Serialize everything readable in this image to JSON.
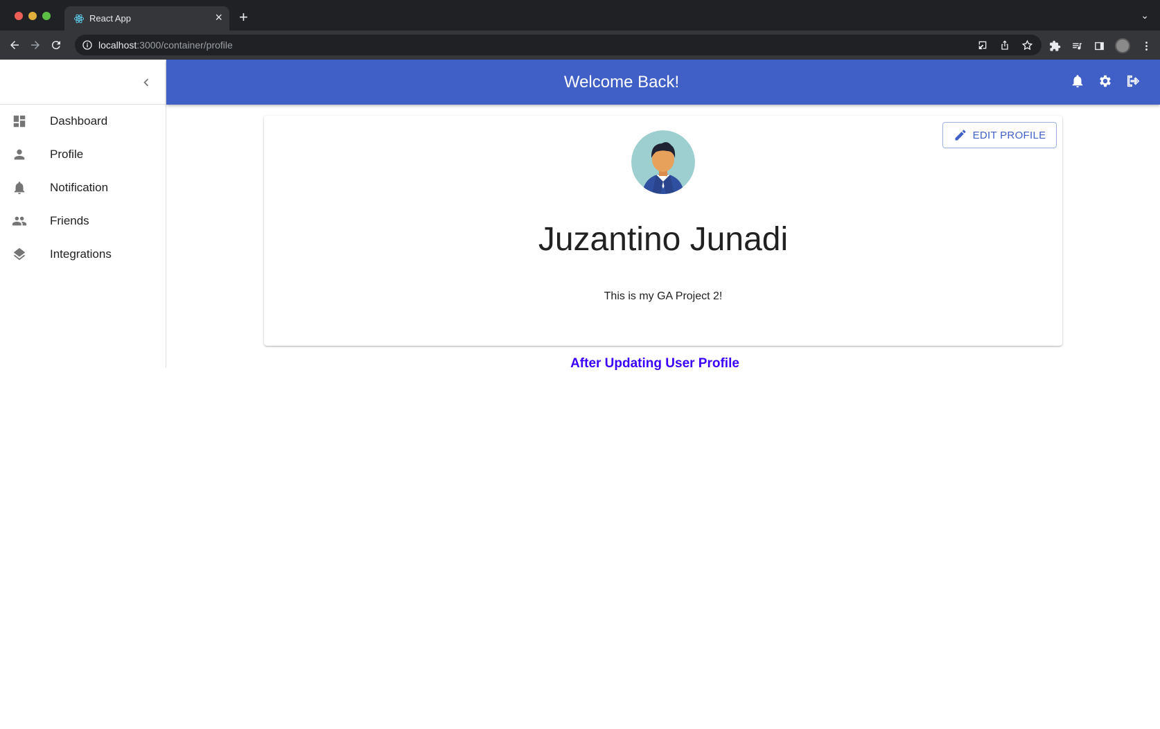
{
  "browser": {
    "tab_title": "React App",
    "tab_close": "×",
    "new_tab": "+",
    "tab_menu": "⌄",
    "url_host": "localhost",
    "url_path": ":3000/container/profile"
  },
  "sidebar": {
    "items": [
      {
        "label": "Dashboard",
        "icon": "dashboard-icon"
      },
      {
        "label": "Profile",
        "icon": "person-icon"
      },
      {
        "label": "Notification",
        "icon": "bell-icon"
      },
      {
        "label": "Friends",
        "icon": "people-icon"
      },
      {
        "label": "Integrations",
        "icon": "layers-icon"
      }
    ]
  },
  "appbar": {
    "title": "Welcome Back!",
    "color": "#4060c8"
  },
  "profile": {
    "edit_label": "EDIT PROFILE",
    "name": "Juzantino Junadi",
    "bio": "This is my GA Project 2!"
  },
  "caption": {
    "text": "After Updating User Profile",
    "color": "#3a00ff"
  }
}
